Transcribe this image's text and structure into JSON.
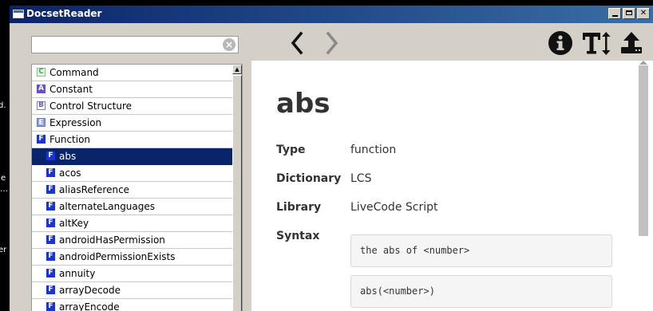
{
  "desktop": {
    "fragments": [
      "d.",
      "e",
      "…",
      "er"
    ]
  },
  "window": {
    "title": "DocsetReader",
    "controls": [
      "minimize",
      "maximize",
      "close"
    ]
  },
  "search": {
    "value": "",
    "placeholder": ""
  },
  "list": {
    "items": [
      {
        "label": "Command",
        "badge": "C",
        "kind": "command",
        "indent": false,
        "selected": false
      },
      {
        "label": "Constant",
        "badge": "A",
        "kind": "constant",
        "indent": false,
        "selected": false
      },
      {
        "label": "Control Structure",
        "badge": "B",
        "kind": "structure",
        "indent": false,
        "selected": false
      },
      {
        "label": "Expression",
        "badge": "E",
        "kind": "expression",
        "indent": false,
        "selected": false
      },
      {
        "label": "Function",
        "badge": "F",
        "kind": "function",
        "indent": false,
        "selected": false
      },
      {
        "label": "abs",
        "badge": "F",
        "kind": "function",
        "indent": true,
        "selected": true
      },
      {
        "label": "acos",
        "badge": "F",
        "kind": "function",
        "indent": true,
        "selected": false
      },
      {
        "label": "aliasReference",
        "badge": "F",
        "kind": "function",
        "indent": true,
        "selected": false
      },
      {
        "label": "alternateLanguages",
        "badge": "F",
        "kind": "function",
        "indent": true,
        "selected": false
      },
      {
        "label": "altKey",
        "badge": "F",
        "kind": "function",
        "indent": true,
        "selected": false
      },
      {
        "label": "androidHasPermission",
        "badge": "F",
        "kind": "function",
        "indent": true,
        "selected": false
      },
      {
        "label": "androidPermissionExists",
        "badge": "F",
        "kind": "function",
        "indent": true,
        "selected": false
      },
      {
        "label": "annuity",
        "badge": "F",
        "kind": "function",
        "indent": true,
        "selected": false
      },
      {
        "label": "arrayDecode",
        "badge": "F",
        "kind": "function",
        "indent": true,
        "selected": false
      },
      {
        "label": "arrayEncode",
        "badge": "F",
        "kind": "function",
        "indent": true,
        "selected": false
      }
    ]
  },
  "toolbar": {
    "back_icon": "chevron-left-icon",
    "forward_icon": "chevron-right-icon",
    "info_icon": "info-icon",
    "text_size_icon": "text-size-icon",
    "export_icon": "upload-icon"
  },
  "doc": {
    "title": "abs",
    "fields": [
      {
        "label": "Type",
        "value": "function"
      },
      {
        "label": "Dictionary",
        "value": "LCS"
      },
      {
        "label": "Library",
        "value": "LiveCode Script"
      }
    ],
    "syntax_label": "Syntax",
    "syntax": [
      "the abs of <number>",
      "abs(<number>)"
    ]
  },
  "colors": {
    "selection": "#0a246a",
    "titlebar": "#0a246a",
    "badge_function": "#1b33d3"
  }
}
